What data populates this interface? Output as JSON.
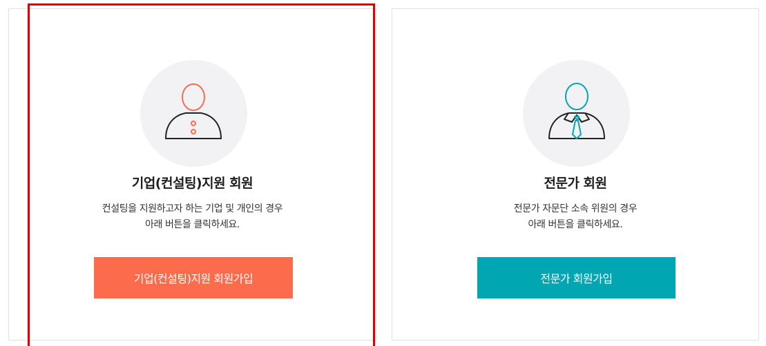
{
  "cards": [
    {
      "id": "corporate",
      "title": "기업(컨설팅)지원 회원",
      "description_line1": "컨설팅을 지원하고자 하는 기업 및 개인의 경우",
      "description_line2": "아래 버튼을 클릭하세요.",
      "button_label": "기업(컨설팅)지원 회원가입",
      "icon": "user-icon",
      "accent_color": "#fd6b4d",
      "selected": true
    },
    {
      "id": "expert",
      "title": "전문가 회원",
      "description_line1": "전문가 자문단 소속 위원의 경우",
      "description_line2": "아래 버튼을 클릭하세요.",
      "button_label": "전문가 회원가입",
      "icon": "expert-icon",
      "accent_color": "#00a7b3",
      "selected": false
    }
  ],
  "colors": {
    "selection_border": "#e00000",
    "card_border": "#e2e2e2",
    "avatar_bg": "#f2f2f4"
  }
}
